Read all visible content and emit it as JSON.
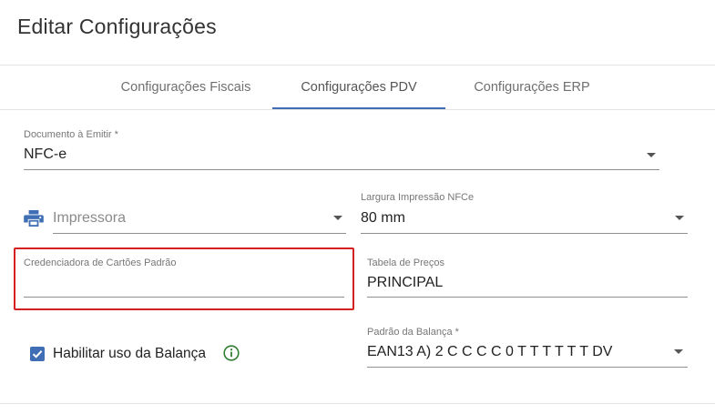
{
  "dialog": {
    "title": "Editar Configurações"
  },
  "tabs": [
    {
      "label": "Configurações Fiscais"
    },
    {
      "label": "Configurações PDV"
    },
    {
      "label": "Configurações ERP"
    }
  ],
  "active_tab": "Configurações PDV",
  "fields": {
    "documento": {
      "label": "Documento à Emitir *",
      "value": "NFC-e"
    },
    "impressora": {
      "placeholder": "Impressora"
    },
    "largura": {
      "label": "Largura Impressão NFCe",
      "value": "80 mm"
    },
    "credenciadora": {
      "label": "Credenciadora de Cartões Padrão",
      "value": ""
    },
    "tabela_precos": {
      "label": "Tabela de Preços",
      "value": "PRINCIPAL"
    },
    "balanca_checkbox": {
      "label": "Habilitar uso da Balança",
      "checked": true
    },
    "padrao_balanca": {
      "label": "Padrão da Balança *",
      "value": "EAN13 A) 2 C C C C 0 T T T T T T DV"
    }
  },
  "colors": {
    "accent": "#3f6eb4",
    "highlight": "#d42020",
    "info_icon": "#2e7d32"
  },
  "icons": {
    "printer": "printer-icon",
    "info": "info-icon",
    "dropdown": "chevron-down-icon",
    "check": "check-icon"
  }
}
